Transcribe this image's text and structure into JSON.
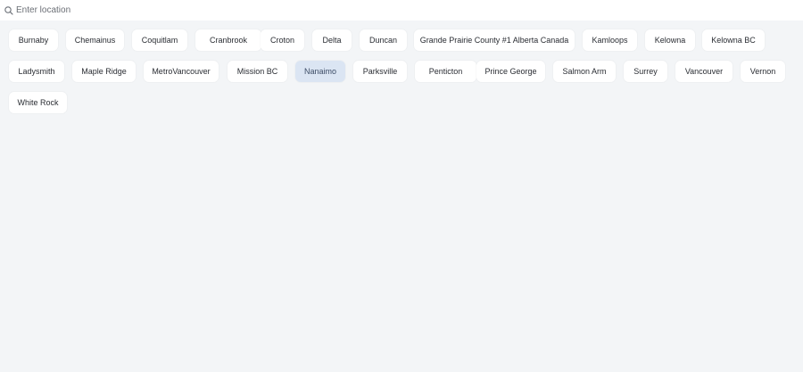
{
  "search": {
    "placeholder": "Enter location",
    "icon": "search-icon"
  },
  "locations": [
    {
      "label": "Burnaby",
      "selected": false
    },
    {
      "label": "Chemainus",
      "selected": false
    },
    {
      "label": "Coquitlam",
      "selected": false
    },
    {
      "label": "Cranbrook",
      "selected": false
    },
    {
      "label": "Croton",
      "selected": false
    },
    {
      "label": "Delta",
      "selected": false
    },
    {
      "label": "Duncan",
      "selected": false
    },
    {
      "label": "Grande Prairie County #1 Alberta Canada",
      "selected": false
    },
    {
      "label": "Kamloops",
      "selected": false
    },
    {
      "label": "Kelowna",
      "selected": false
    },
    {
      "label": "Kelowna BC",
      "selected": false
    },
    {
      "label": "Ladysmith",
      "selected": false
    },
    {
      "label": "Maple Ridge",
      "selected": false
    },
    {
      "label": "MetroVancouver",
      "selected": false
    },
    {
      "label": "Mission BC",
      "selected": false
    },
    {
      "label": "Nanaimo",
      "selected": true
    },
    {
      "label": "Parksville",
      "selected": false
    },
    {
      "label": "Penticton",
      "selected": false
    },
    {
      "label": "Prince George",
      "selected": false
    },
    {
      "label": "Salmon Arm",
      "selected": false
    },
    {
      "label": "Surrey",
      "selected": false
    },
    {
      "label": "Vancouver",
      "selected": false
    },
    {
      "label": "Vernon",
      "selected": false
    },
    {
      "label": "White Rock",
      "selected": false
    }
  ],
  "colors": {
    "background": "#f3f5f7",
    "chip": "#ffffff",
    "chip_selected": "#dbe5f3"
  }
}
